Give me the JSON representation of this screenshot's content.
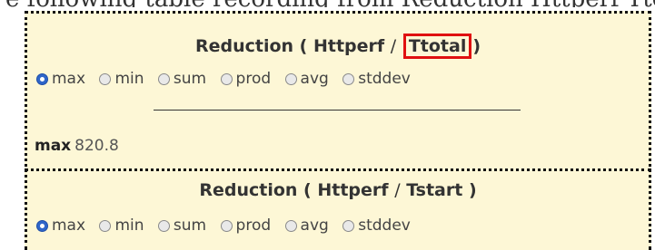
{
  "top_snippet": "e following table recording from Reduction Httperf Ttotal),",
  "panels": [
    {
      "title_prefix": "Reduction (",
      "title_app": "Httperf",
      "title_sep": "/",
      "title_metric": "Ttotal",
      "title_suffix": ")",
      "metric_highlighted": true,
      "highlight_color": "#e01010",
      "options": [
        "max",
        "min",
        "sum",
        "prod",
        "avg",
        "stddev"
      ],
      "selected": "max",
      "result_label": "max",
      "result_value": "820.8"
    },
    {
      "title_prefix": "Reduction (",
      "title_app": "Httperf",
      "title_sep": "/",
      "title_metric": "Tstart",
      "title_suffix": ")",
      "metric_highlighted": false,
      "options": [
        "max",
        "min",
        "sum",
        "prod",
        "avg",
        "stddev"
      ],
      "selected": "max"
    }
  ],
  "colors": {
    "panel_bg": "#fdf7d6",
    "radio_selected": "#2f66c9"
  }
}
